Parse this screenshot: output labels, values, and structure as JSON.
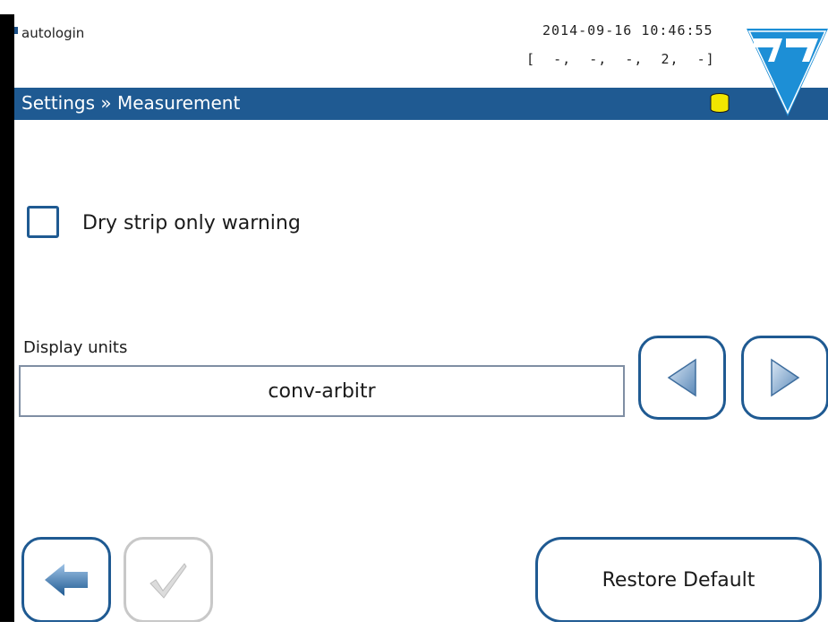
{
  "status_bar": {
    "user": "autologin",
    "datetime": "2014-09-16  10:46:55",
    "counters": "[  -,  -,  -,  2,  -]"
  },
  "title_bar": {
    "breadcrumb": "Settings » Measurement",
    "database_icon": "database-icon"
  },
  "logo_icon": "brand-logo",
  "settings": {
    "dry_strip_warning": {
      "label": "Dry strip only warning",
      "checked": false
    },
    "display_units": {
      "label": "Display units",
      "value": "conv-arbitr",
      "prev_icon": "triangle-left-icon",
      "next_icon": "triangle-right-icon"
    }
  },
  "footer": {
    "back_icon": "arrow-left-icon",
    "confirm_icon": "checkmark-icon",
    "confirm_enabled": false,
    "restore_label": "Restore Default"
  },
  "colors": {
    "accent": "#1f5a92",
    "title_text": "#ffffff",
    "database_icon": "#f2e600",
    "disabled": "#c8c8c8"
  }
}
